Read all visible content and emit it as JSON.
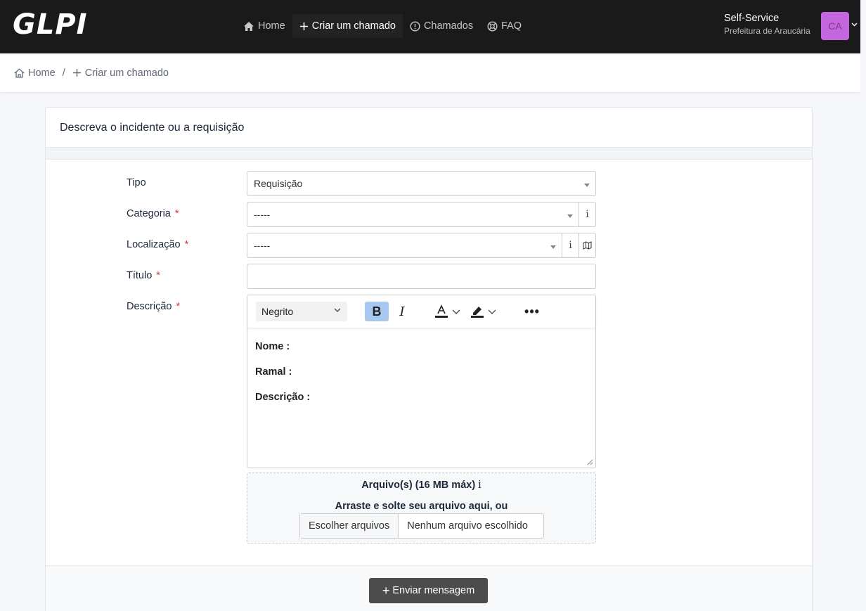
{
  "app": {
    "logo": "GLPI"
  },
  "nav": {
    "items": [
      {
        "label": "Home",
        "icon": "home-icon"
      },
      {
        "label": "Criar um chamado",
        "icon": "plus-icon"
      },
      {
        "label": "Chamados",
        "icon": "alert-circle-icon"
      },
      {
        "label": "FAQ",
        "icon": "lifebuoy-icon"
      }
    ]
  },
  "user": {
    "profile": "Self-Service",
    "entity": "Prefeitura de Araucária",
    "initials": "CA"
  },
  "breadcrumb": {
    "home": "Home",
    "separator": "/",
    "current": "Criar um chamado"
  },
  "form": {
    "header": "Descreva o incidente ou a requisição",
    "required_mark": "*",
    "tipo": {
      "label": "Tipo",
      "value": "Requisição"
    },
    "categoria": {
      "label": "Categoria",
      "value": "-----",
      "info": "i"
    },
    "localizacao": {
      "label": "Localização",
      "value": "-----",
      "info": "i"
    },
    "titulo": {
      "label": "Título",
      "value": ""
    },
    "descricao": {
      "label": "Descrição",
      "format": "Negrito",
      "bold": "B",
      "italic": "I",
      "more": "•••",
      "lines": [
        "Nome :",
        "Ramal :",
        "Descrição :"
      ]
    },
    "files": {
      "title": "Arquivo(s) (16 MB máx)",
      "info": "i",
      "drag_text": "Arraste e solte seu arquivo aqui, ou",
      "choose_button": "Escolher arquivos",
      "no_file": "Nenhum arquivo escolhido"
    },
    "submit": "Enviar mensagem"
  },
  "colors": {
    "topbar": "#1a1a1a",
    "avatar": "#c466dd",
    "required": "#d63939",
    "bold_active": "#a7c8f0",
    "submit": "#4c4c4c"
  }
}
